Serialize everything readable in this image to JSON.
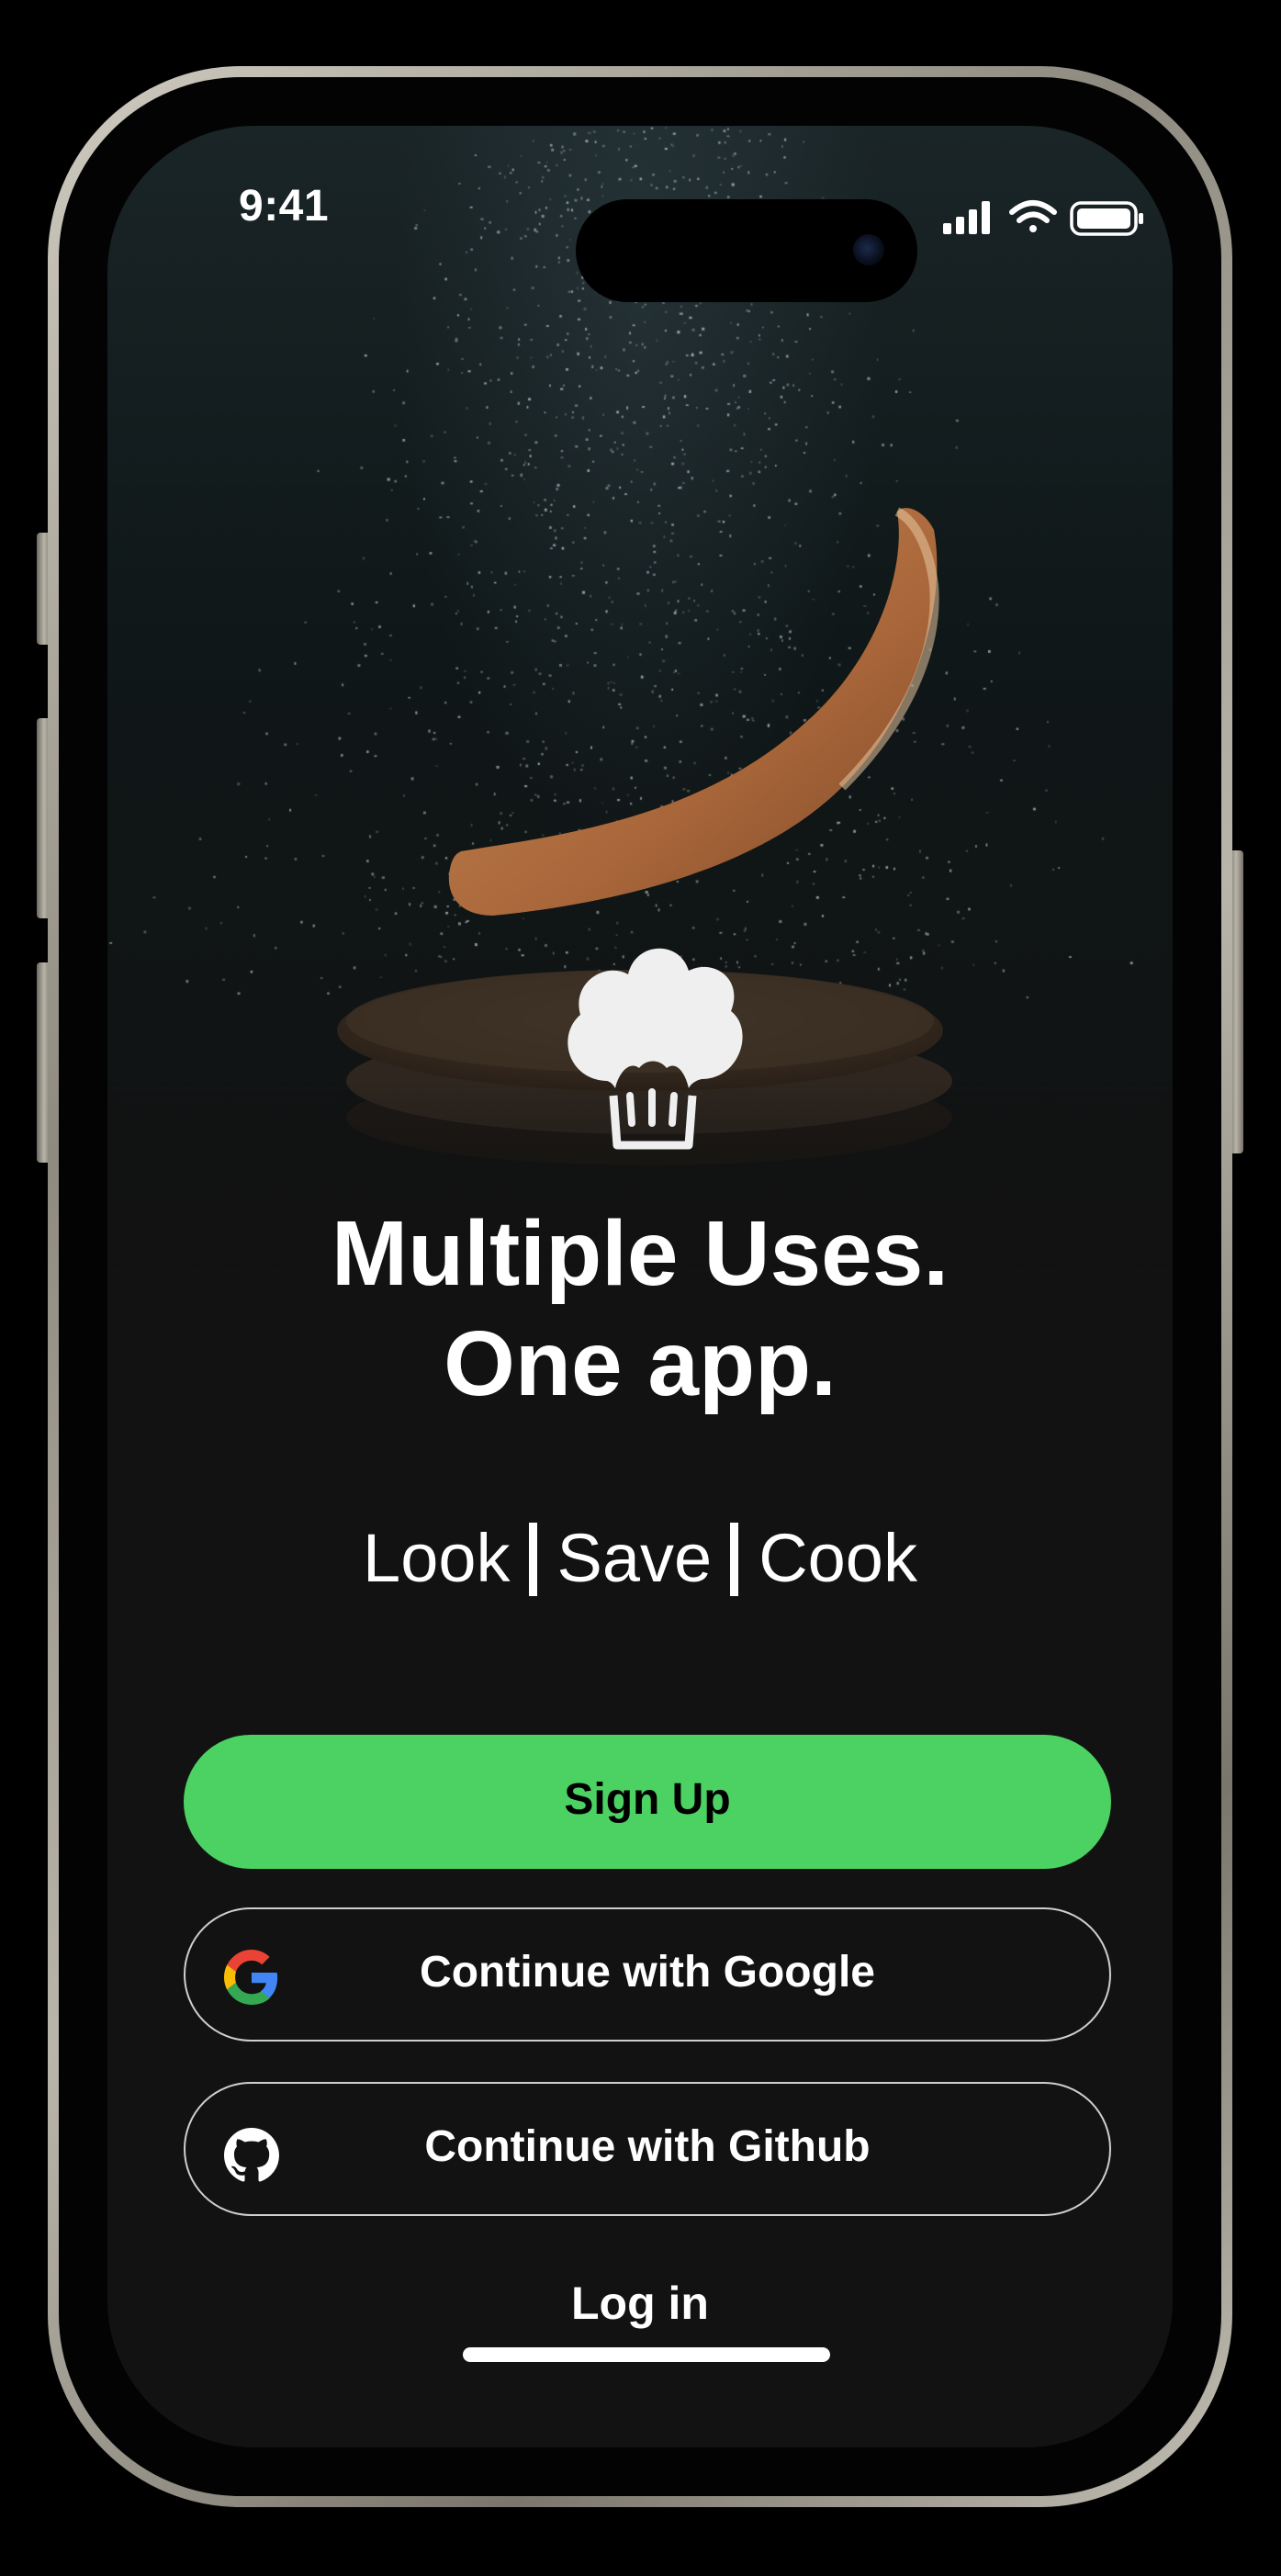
{
  "status_bar": {
    "time": "9:41",
    "icons": [
      "signal-icon",
      "wifi-icon",
      "battery-icon"
    ]
  },
  "hero": {
    "logo_icon": "chef-hat-icon",
    "headline_line1": "Multiple Uses.",
    "headline_line2": "One app.",
    "tagline_items": [
      "Look",
      "Save",
      "Cook"
    ]
  },
  "actions": {
    "signup_label": "Sign Up",
    "google_label": "Continue with Google",
    "google_icon": "google-icon",
    "github_label": "Continue with Github",
    "github_icon": "github-icon",
    "login_label": "Log in"
  },
  "colors": {
    "accent": "#4CD263",
    "background": "#121212",
    "text": "#FFFFFF",
    "outline": "#CFCFCF"
  }
}
